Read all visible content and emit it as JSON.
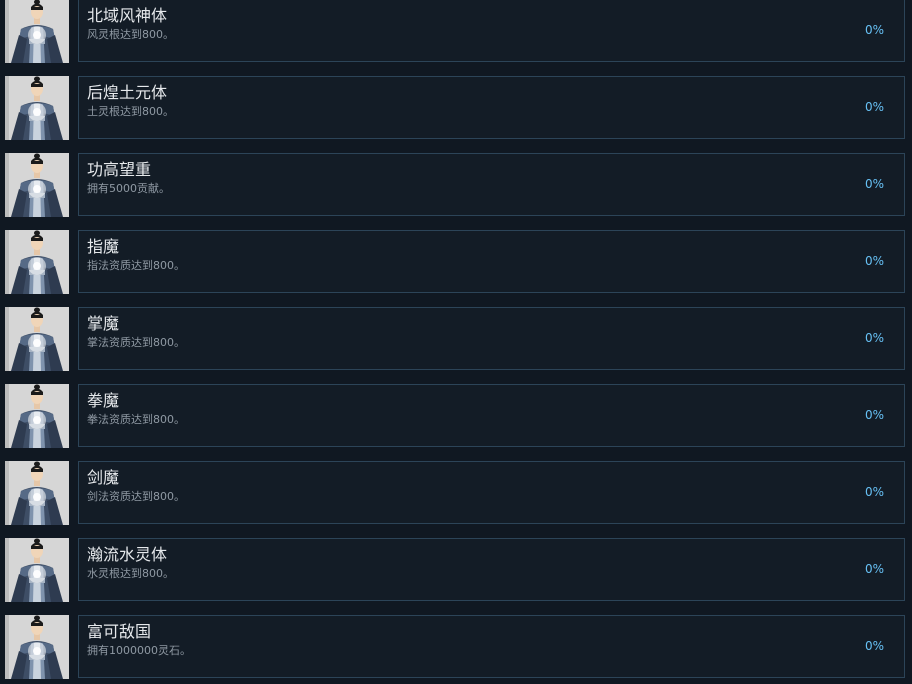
{
  "achievements": [
    {
      "title": "北域风神体",
      "description": "风灵根达到800。",
      "percent": "0%",
      "icon": "cultivator-portrait-icon"
    },
    {
      "title": "后煌土元体",
      "description": "土灵根达到800。",
      "percent": "0%",
      "icon": "cultivator-portrait-icon"
    },
    {
      "title": "功高望重",
      "description": "拥有5000贡献。",
      "percent": "0%",
      "icon": "cultivator-portrait-icon"
    },
    {
      "title": "指魔",
      "description": "指法资质达到800。",
      "percent": "0%",
      "icon": "cultivator-portrait-icon"
    },
    {
      "title": "掌魔",
      "description": "掌法资质达到800。",
      "percent": "0%",
      "icon": "cultivator-portrait-icon"
    },
    {
      "title": "拳魔",
      "description": "拳法资质达到800。",
      "percent": "0%",
      "icon": "cultivator-portrait-icon"
    },
    {
      "title": "剑魔",
      "description": "剑法资质达到800。",
      "percent": "0%",
      "icon": "cultivator-portrait-icon"
    },
    {
      "title": "瀚流水灵体",
      "description": "水灵根达到800。",
      "percent": "0%",
      "icon": "cultivator-portrait-icon"
    },
    {
      "title": "富可敌国",
      "description": "拥有1000000灵石。",
      "percent": "0%",
      "icon": "cultivator-portrait-icon"
    }
  ],
  "colors": {
    "background": "#101822",
    "panel_border": "#2c4458",
    "title_text": "#e6e9ec",
    "description_text": "#8f99a3",
    "percent_text": "#67c1f5"
  }
}
